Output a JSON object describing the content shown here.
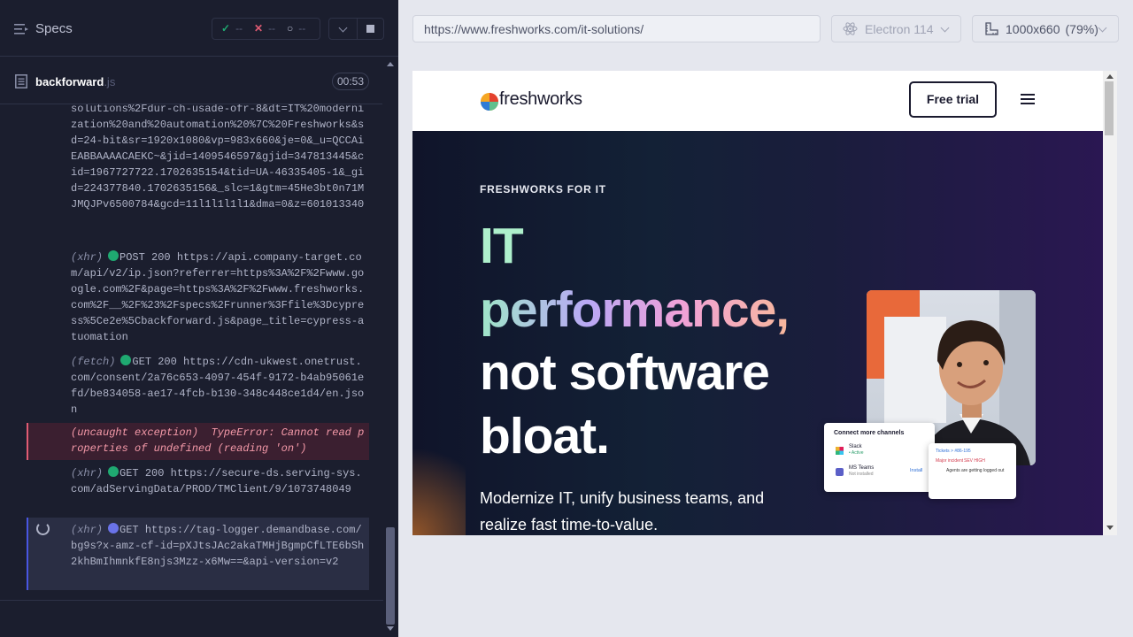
{
  "reporter": {
    "title": "Specs",
    "stats": {
      "passed": "--",
      "failed": "--",
      "pending": "--"
    },
    "spec": {
      "name": "backforward",
      "ext": ".js",
      "duration": "00:53"
    },
    "log": [
      {
        "kind": "",
        "text": "solutions%2Fdur-ch-usade-ofr-8&dt=IT%20modernization%20and%20automation%20%7C%20Freshworks&sd=24-bit&sr=1920x1080&vp=983x660&je=0&_u=QCCAiEABBAAAACAEKC~&jid=1409546597&gjid=347813445&cid=1967727722.1702635154&tid=UA-46335405-1&_gid=224377840.1702635156&_slc=1&gtm=45He3bt0n71MJMQJPv6500784&gcd=11l1l1l1l1&dma=0&z=601013340"
      },
      {
        "kind": "(xhr)",
        "method": "POST",
        "status": "200",
        "text": "https://api.company-target.com/api/v2/ip.json?referrer=https%3A%2F%2Fwww.google.com%2F&page=https%3A%2F%2Fwww.freshworks.com%2F__%2F%23%2Fspecs%2Frunner%3Ffile%3Dcypress%5Ce2e%5Cbackforward.js&page_title=cypress-atuomation"
      },
      {
        "kind": "(fetch)",
        "method": "GET",
        "status": "200",
        "text": "https://cdn-ukwest.onetrust.com/consent/2a76c653-4097-454f-9172-b4ab95061efd/be834058-ae17-4fcb-b130-348c448ce1d4/en.json"
      },
      {
        "kind": "(uncaught exception)",
        "text": "TypeError: Cannot read properties of undefined (reading 'on')"
      },
      {
        "kind": "(xhr)",
        "method": "GET",
        "status": "200",
        "text": "https://secure-ds.serving-sys.com/adServingData/PROD/TMClient/9/1073748049"
      },
      {
        "kind": "(xhr)",
        "method": "GET",
        "status": "",
        "text": "https://tag-logger.demandbase.com/bg9s?x-amz-cf-id=pXJtsJAc2akaTMHjBgmpCfLTE6bSh2khBmIhmnkfE8njs3Mzz-x6Mw==&api-version=v2"
      }
    ]
  },
  "browser": {
    "url": "https://www.freshworks.com/it-solutions/",
    "engine": "Electron 114",
    "viewport_size": "1000x660",
    "viewport_zoom": "(79%)"
  },
  "site": {
    "logo": "freshworks",
    "cta": "Free trial",
    "eyebrow": "FRESHWORKS FOR IT",
    "headline": [
      "IT",
      "performance,",
      "not software",
      "bloat."
    ],
    "subhead": "Modernize IT, unify business teams, and realize fast time-to-value.",
    "card_main": {
      "title": "Connect more channels",
      "items": [
        {
          "name": "Slack",
          "status": "• Active"
        },
        {
          "name": "MS Teams",
          "status": "Not installed",
          "action": "Install"
        }
      ]
    },
    "card_side": {
      "crumb": "Tickets > #86-195",
      "tags": [
        "Major incident",
        "SEV HIGH"
      ],
      "note": "Agents are getting logged out"
    }
  }
}
